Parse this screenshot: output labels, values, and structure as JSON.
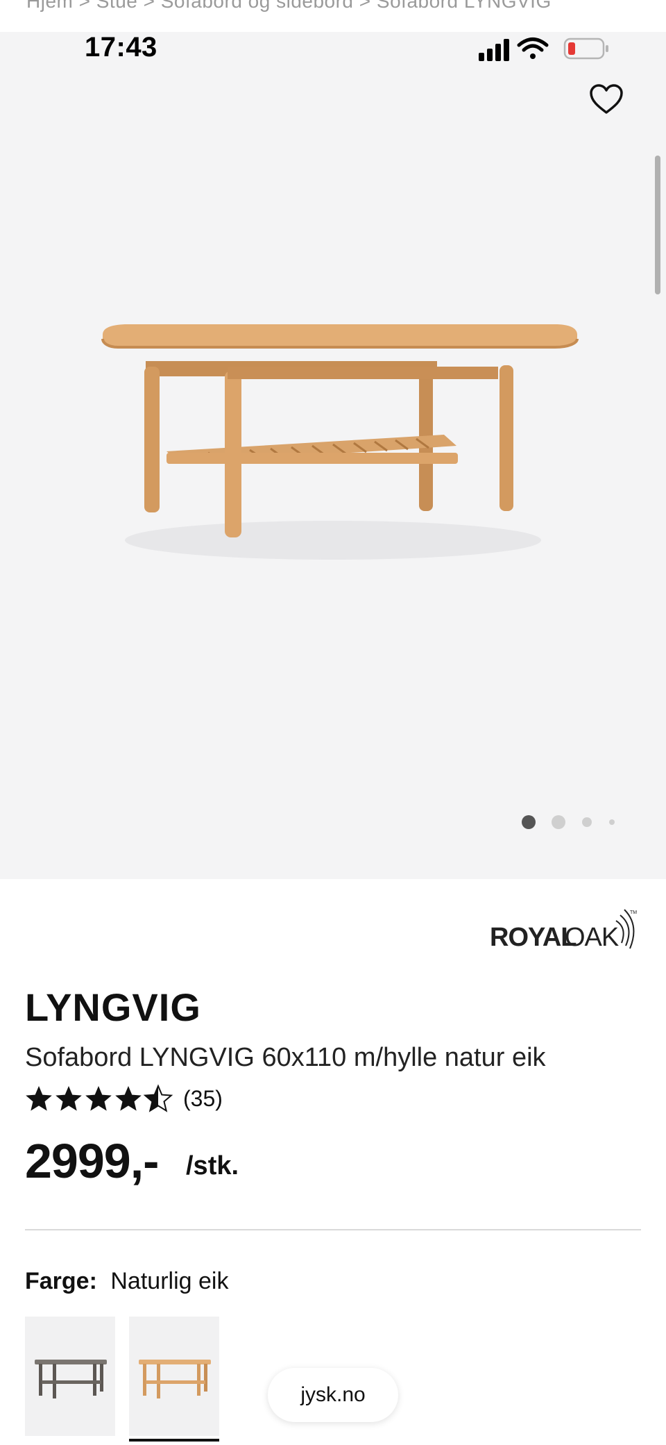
{
  "breadcrumb": "Hjem  >  Stue  >  Sofabord og sidebord  >  Sofabord LYNGVIG",
  "status": {
    "time": "17:43"
  },
  "product": {
    "brand": "ROYALOAK",
    "name": "LYNGVIG",
    "description": "Sofabord LYNGVIG 60x110 m/hylle natur eik",
    "rating": 4.5,
    "rating_count": "(35)",
    "price": "2999,-",
    "unit": "/stk."
  },
  "gallery": {
    "slides_total": 4,
    "active_index": 0
  },
  "color": {
    "label": "Farge:",
    "value": "Naturlig eik",
    "options": [
      {
        "name": "Grå",
        "selected": false
      },
      {
        "name": "Naturlig eik",
        "selected": true
      }
    ]
  },
  "browser": {
    "url": "jysk.no"
  },
  "colors": {
    "hero_bg": "#f4f4f5",
    "wood": "#d9a36a",
    "wood_dark": "#c78e55",
    "text": "#111111",
    "battery_low": "#e53935"
  }
}
